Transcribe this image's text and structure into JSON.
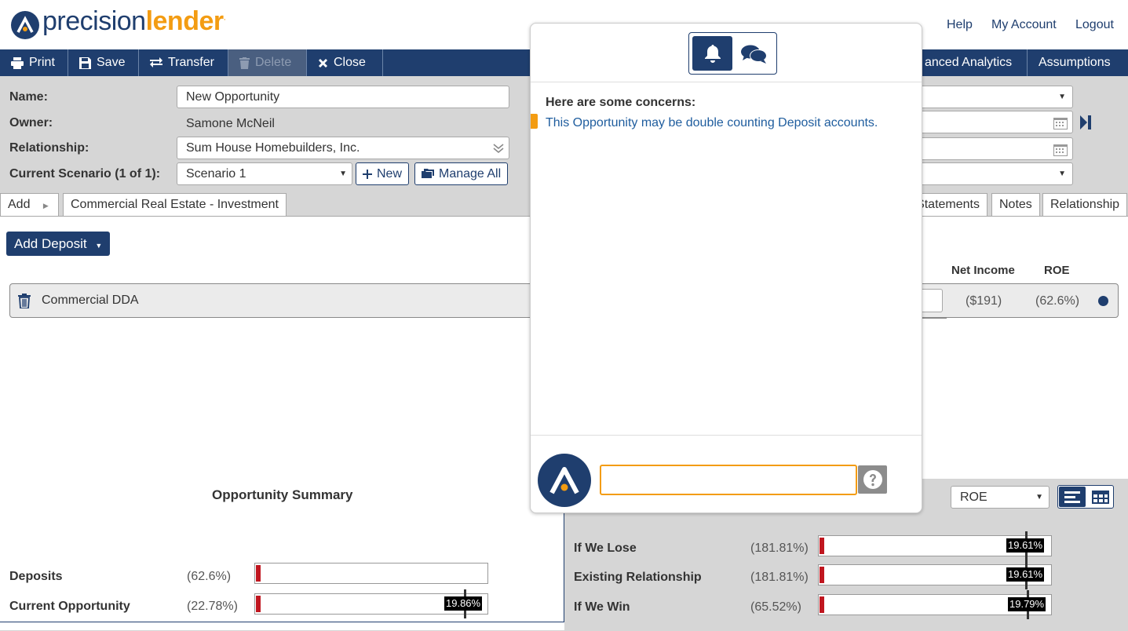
{
  "header": {
    "logo_part1": "precision",
    "logo_part2": "lender",
    "logo_reg": ".",
    "links": [
      "Help",
      "My Account",
      "Logout"
    ]
  },
  "toolbar": {
    "print": "Print",
    "save": "Save",
    "transfer": "Transfer",
    "delete": "Delete",
    "close": "Close",
    "advanced_analytics": "anced Analytics",
    "assumptions": "Assumptions"
  },
  "form": {
    "name_label": "Name:",
    "name_value": "New Opportunity",
    "owner_label": "Owner:",
    "owner_value": "Samone McNeil",
    "relationship_label": "Relationship:",
    "relationship_value": "Sum House Homebuilders, Inc.",
    "scenario_label": "Current Scenario (1 of 1):",
    "scenario_value": "Scenario 1",
    "new_button": "New",
    "manage_all_button": "Manage All"
  },
  "tabs": {
    "add": "Add",
    "commercial_real_estate": "Commercial Real Estate - Investment",
    "statements": "Statements",
    "notes": "Notes",
    "relationship": "Relationship"
  },
  "deposits": {
    "add_button": "Add Deposit",
    "col_net_income": "Net Income",
    "col_roe": "ROE",
    "row_name": "Commercial DDA",
    "row_net_income": "($191)",
    "row_roe": "(62.6%)"
  },
  "summary": {
    "title": "Opportunity Summary",
    "rows": [
      {
        "label": "Deposits",
        "value": "(62.6%)",
        "marker": ""
      },
      {
        "label": "Current Opportunity",
        "value": "(22.78%)",
        "marker": "19.86%"
      }
    ],
    "metric_select": "ROE",
    "right_rows": [
      {
        "label": "If We Lose",
        "value": "(181.81%)",
        "marker": "19.61%"
      },
      {
        "label": "Existing Relationship",
        "value": "(181.81%)",
        "marker": "19.61%"
      },
      {
        "label": "If We Win",
        "value": "(65.52%)",
        "marker": "19.79%"
      }
    ]
  },
  "popup": {
    "concerns_title": "Here are some concerns:",
    "concern_1": "This Opportunity may be double counting Deposit accounts.",
    "chat_value": ""
  },
  "colors": {
    "brand_navy": "#1f3e6e",
    "brand_orange": "#f39c12",
    "alert_red": "#c0161f"
  }
}
